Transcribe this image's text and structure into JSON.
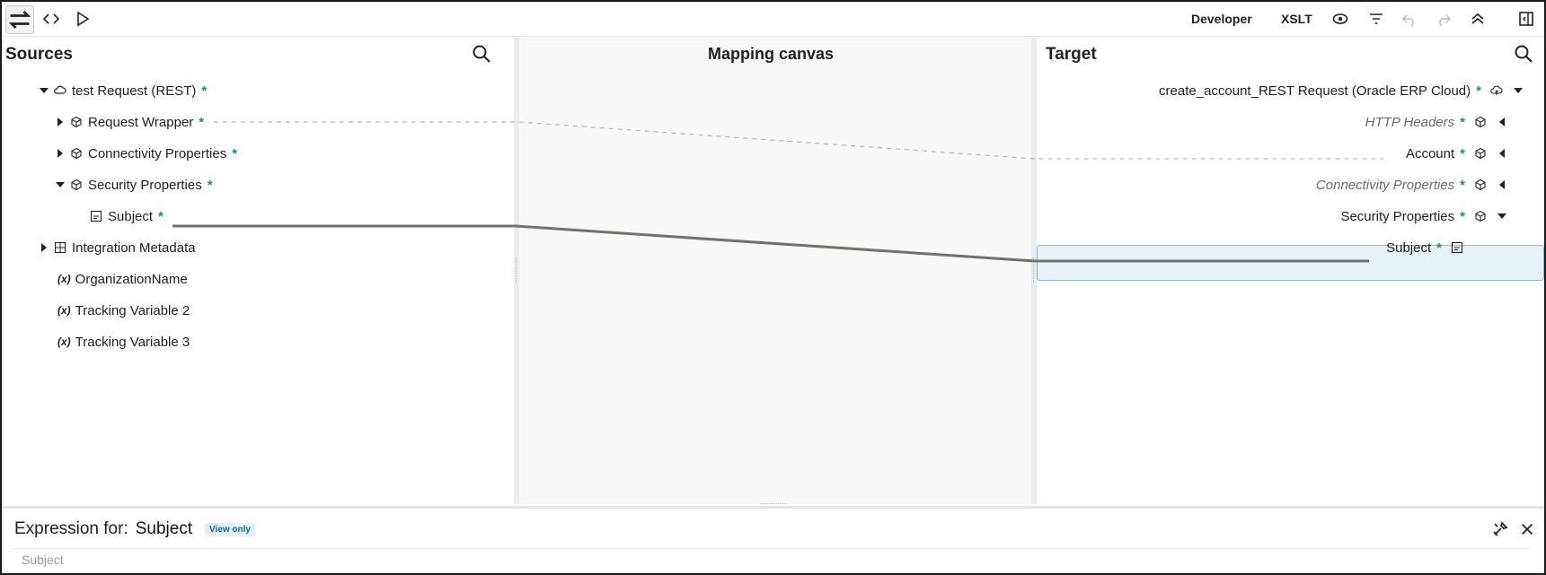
{
  "toolbar": {
    "mode_label": "Developer",
    "xslt_label": "XSLT"
  },
  "sources": {
    "title": "Sources",
    "items": [
      {
        "label": "test Request (REST)",
        "required": "*"
      },
      {
        "label": "Request Wrapper",
        "required": "*"
      },
      {
        "label": "Connectivity Properties",
        "required": "*"
      },
      {
        "label": "Security Properties",
        "required": "*"
      },
      {
        "label": "Subject",
        "required": "*"
      },
      {
        "label": "Integration Metadata"
      },
      {
        "label": "OrganizationName",
        "prefix": "(x)"
      },
      {
        "label": "Tracking Variable 2",
        "prefix": "(x)"
      },
      {
        "label": "Tracking Variable 3",
        "prefix": "(x)"
      }
    ]
  },
  "canvas": {
    "title": "Mapping canvas"
  },
  "target": {
    "title": "Target",
    "items": [
      {
        "label": "create_account_REST Request (Oracle ERP Cloud)",
        "required": "*"
      },
      {
        "label": "HTTP Headers",
        "required": "*"
      },
      {
        "label": "Account",
        "required": "*"
      },
      {
        "label": "Connectivity Properties",
        "required": "*"
      },
      {
        "label": "Security Properties",
        "required": "*"
      },
      {
        "label": "Subject",
        "required": "*"
      }
    ]
  },
  "expression": {
    "label": "Expression for:",
    "field": "Subject",
    "badge": "View only",
    "placeholder": "Subject"
  },
  "colors": {
    "required_star": "#1a8a8a",
    "selected_bg": "#e7f1f8",
    "wire": "#6f7468"
  }
}
